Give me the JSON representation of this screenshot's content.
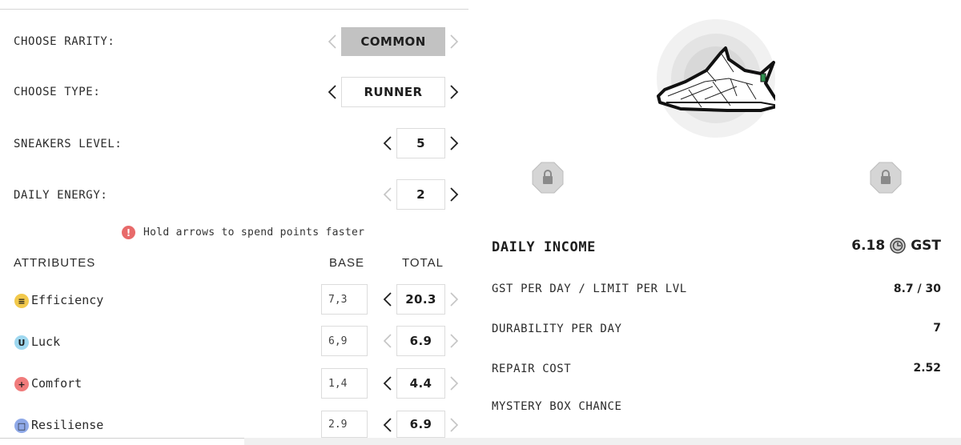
{
  "controls": {
    "rarity": {
      "label": "CHOOSE RARITY:",
      "value": "COMMON"
    },
    "type": {
      "label": "CHOOSE TYPE:",
      "value": "RUNNER"
    },
    "level": {
      "label": "SNEAKERS LEVEL:",
      "value": "5"
    },
    "energy": {
      "label": "DAILY ENERGY:",
      "value": "2"
    }
  },
  "hint": {
    "icon": "!",
    "text": "Hold arrows to spend points faster"
  },
  "attributes": {
    "heading": "ATTRIBUTES",
    "base_heading": "BASE",
    "total_heading": "TOTAL",
    "items": [
      {
        "name": "Efficiency",
        "icon_glyph": "≡",
        "icon_color": "#f2c94c",
        "base": "7,3",
        "total": "20.3"
      },
      {
        "name": "Luck",
        "icon_glyph": "U",
        "icon_color": "#9fd8f0",
        "base": "6,9",
        "total": "6.9"
      },
      {
        "name": "Comfort",
        "icon_glyph": "+",
        "icon_color": "#f07b7b",
        "base": "1,4",
        "total": "4.4"
      },
      {
        "name": "Resiliense",
        "icon_glyph": "□",
        "icon_color": "#8fa9e8",
        "base": "2.9",
        "total": "6.9"
      }
    ]
  },
  "stats": {
    "daily_income": {
      "label": "DAILY INCOME",
      "value": "6.18",
      "currency": "GST"
    },
    "gst_per_day": {
      "label": "GST PER DAY / LIMIT PER LVL",
      "value": "8.7 / 30"
    },
    "durability": {
      "label": "DURABILITY PER DAY",
      "value": "7"
    },
    "repair": {
      "label": "REPAIR COST",
      "value": "2.52"
    },
    "mystery": {
      "label": "MYSTERY BOX CHANCE"
    }
  },
  "colors": {
    "accent_gray": "#c2c2c2",
    "hint_red": "#e86a6a",
    "lock_gray": "#d5d5d5"
  },
  "icons": {
    "arrow_left": "chevron-left-icon",
    "arrow_right": "chevron-right-icon",
    "lock": "lock-icon",
    "coin": "gst-coin-icon",
    "sneaker": "sneaker-image"
  }
}
